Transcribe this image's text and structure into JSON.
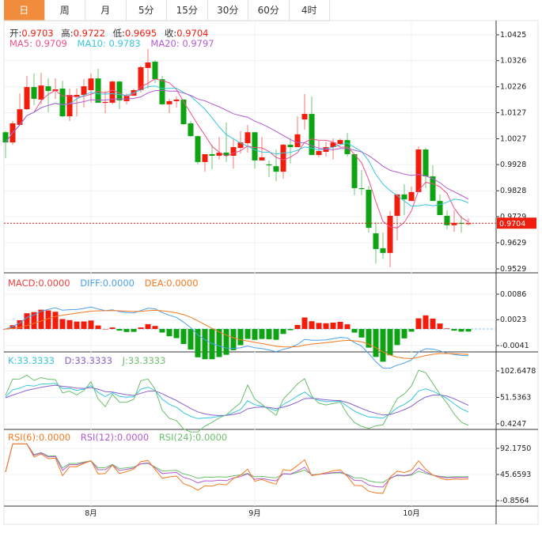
{
  "tabs": [
    {
      "label": "日",
      "active": true
    },
    {
      "label": "周"
    },
    {
      "label": "月"
    },
    {
      "label": "5分"
    },
    {
      "label": "15分"
    },
    {
      "label": "30分"
    },
    {
      "label": "60分"
    },
    {
      "label": "4时"
    }
  ],
  "ohlc_legend": {
    "open_label": "开:",
    "open": "0.9703",
    "high_label": "高:",
    "high": "0.9722",
    "low_label": "低:",
    "low": "0.9695",
    "close_label": "收:",
    "close": "0.9704"
  },
  "ma_legend": {
    "ma5": "MA5: 0.9709",
    "ma10": "MA10: 0.9783",
    "ma20": "MA20: 0.9797"
  },
  "macd_legend": {
    "macd": "MACD:0.0000",
    "diff": "DIFF:0.0000",
    "dea": "DEA:0.0000"
  },
  "kdj_legend": {
    "k": "K:33.3333",
    "d": "D:33.3333",
    "j": "J:33.3333"
  },
  "rsi_legend": {
    "rsi6": "RSI(6):0.0000",
    "rsi12": "RSI(12):0.0000",
    "rsi24": "RSI(24):0.0000"
  },
  "price_axis": [
    "1.0425",
    "1.0326",
    "1.0226",
    "1.0127",
    "1.0027",
    "0.9928",
    "0.9828",
    "0.9729",
    "0.9629",
    "0.9529"
  ],
  "last_price": "0.9704",
  "macd_axis": [
    "0.0086",
    "0.0023",
    "-0.0041"
  ],
  "kdj_axis": [
    "102.6478",
    "51.5363",
    "0.4247"
  ],
  "rsi_axis": [
    "92.1750",
    "45.6593",
    "-0.8564"
  ],
  "x_axis": [
    {
      "label": "8月",
      "index": 12
    },
    {
      "label": "9月",
      "index": 35
    },
    {
      "label": "10月",
      "index": 57
    }
  ],
  "colors": {
    "up": "#f21c0d",
    "down": "#0ea312",
    "accent": "#f28c3d",
    "ma5": "#f0508a",
    "ma10": "#38c6dc",
    "ma20": "#b35bd0",
    "diff": "#4aa0ee",
    "dea": "#f47a20",
    "k": "#38c6dc",
    "d": "#8a60d0",
    "j": "#6cbf6c",
    "rsi6": "#f47a20",
    "rsi12": "#b35bd0",
    "rsi24": "#6cbf6c"
  },
  "chart_data": {
    "type": "candlestick",
    "columns": [
      "open",
      "close",
      "high",
      "low"
    ],
    "candles": [
      [
        1.0052,
        1.0013,
        1.0058,
        0.9953
      ],
      [
        1.0013,
        1.0086,
        1.0095,
        1.0004
      ],
      [
        1.008,
        1.014,
        1.0201,
        1.008
      ],
      [
        1.014,
        1.0225,
        1.0268,
        1.0137
      ],
      [
        1.0225,
        1.018,
        1.0277,
        1.0156
      ],
      [
        1.0177,
        1.0231,
        1.028,
        1.0159
      ],
      [
        1.0228,
        1.021,
        1.0258,
        1.0128
      ],
      [
        1.021,
        1.0216,
        1.0258,
        1.018
      ],
      [
        1.0219,
        1.0113,
        1.0249,
        1.011
      ],
      [
        1.0113,
        1.0195,
        1.0219,
        1.0095
      ],
      [
        1.0189,
        1.0195,
        1.0219,
        1.0113
      ],
      [
        1.0195,
        1.0228,
        1.0255,
        1.0146
      ],
      [
        1.0213,
        1.0258,
        1.0277,
        1.0165
      ],
      [
        1.0258,
        1.0165,
        1.0295,
        1.0165
      ],
      [
        1.0165,
        1.0168,
        1.021,
        1.0125
      ],
      [
        1.0165,
        1.0246,
        1.0249,
        1.0159
      ],
      [
        1.0246,
        1.0174,
        1.0249,
        1.014
      ],
      [
        1.0171,
        1.0192,
        1.0201,
        1.0159
      ],
      [
        1.0192,
        1.0213,
        1.0219,
        1.0192
      ],
      [
        1.0213,
        1.0301,
        1.0307,
        1.0204
      ],
      [
        1.0298,
        1.0319,
        1.0371,
        1.0219
      ],
      [
        1.0322,
        1.0255,
        1.0328,
        1.024
      ],
      [
        1.0255,
        1.0159,
        1.0268,
        1.0156
      ],
      [
        1.0159,
        1.0171,
        1.018,
        1.0125
      ],
      [
        1.0171,
        1.0177,
        1.0189,
        1.0146
      ],
      [
        1.0177,
        1.0083,
        1.018,
        1.008
      ],
      [
        1.0086,
        1.0037,
        1.0095,
        1.0034
      ],
      [
        1.0037,
        0.9938,
        1.004,
        0.9929
      ],
      [
        0.9938,
        0.9968,
        0.9968,
        0.9901
      ],
      [
        0.9968,
        0.9962,
        1.0004,
        0.991
      ],
      [
        0.9962,
        0.9974,
        1.0034,
        0.9947
      ],
      [
        0.9974,
        0.9962,
        1.0089,
        0.9938
      ],
      [
        0.9962,
        0.9995,
        1.0025,
        0.9913
      ],
      [
        0.9992,
        1.0013,
        1.0056,
        0.9971
      ],
      [
        1.001,
        1.0052,
        1.008,
        0.9974
      ],
      [
        1.0052,
        0.9944,
        1.0052,
        0.9913
      ],
      [
        0.9944,
        0.9956,
        1.0034,
        0.9944
      ],
      [
        0.9929,
        0.9926,
        0.9944,
        0.988
      ],
      [
        0.9922,
        0.9901,
        0.9986,
        0.9865
      ],
      [
        0.9901,
        1.0004,
        1.0007,
        0.9874
      ],
      [
        1.0004,
        0.9995,
        1.0028,
        0.9932
      ],
      [
        0.9995,
        1.0044,
        1.0113,
        0.9995
      ],
      [
        1.0101,
        1.0122,
        1.0198,
        1.0062
      ],
      [
        1.0122,
        0.9965,
        1.0189,
        0.9965
      ],
      [
        0.9965,
        0.998,
        1.0019,
        0.9956
      ],
      [
        0.9977,
        0.9995,
        1.0016,
        0.9959
      ],
      [
        0.9995,
        1.0013,
        1.0028,
        0.9947
      ],
      [
        1.0007,
        1.0022,
        1.0028,
        1.0007
      ],
      [
        1.0022,
        0.9968,
        1.0049,
        0.9959
      ],
      [
        0.9968,
        0.9838,
        0.9968,
        0.9811
      ],
      [
        0.9838,
        0.9835,
        0.9907,
        0.9811
      ],
      [
        0.9832,
        0.9686,
        0.9847,
        0.9668
      ],
      [
        0.9665,
        0.9605,
        0.9708,
        0.955
      ],
      [
        0.9608,
        0.959,
        0.9668,
        0.9568
      ],
      [
        0.959,
        0.9732,
        0.975,
        0.9535
      ],
      [
        0.9732,
        0.9814,
        0.9814,
        0.9638
      ],
      [
        0.9814,
        0.9795,
        0.9853,
        0.9735
      ],
      [
        0.9789,
        0.9823,
        0.9844,
        0.9789
      ],
      [
        0.9823,
        0.9986,
        0.9998,
        0.9823
      ],
      [
        0.9986,
        0.9883,
        0.9992,
        0.9838
      ],
      [
        0.9883,
        0.9789,
        0.9925,
        0.9789
      ],
      [
        0.9789,
        0.9735,
        0.9814,
        0.9735
      ],
      [
        0.9732,
        0.9696,
        0.9753,
        0.968
      ],
      [
        0.9696,
        0.9705,
        0.9753,
        0.9671
      ],
      [
        0.9705,
        0.9702,
        0.9732,
        0.9668
      ],
      [
        0.9703,
        0.9704,
        0.9722,
        0.9695
      ]
    ],
    "price_range": [
      0.9529,
      1.0425
    ],
    "indicators": [
      "MA5",
      "MA10",
      "MA20",
      "MACD",
      "KDJ",
      "RSI"
    ]
  }
}
